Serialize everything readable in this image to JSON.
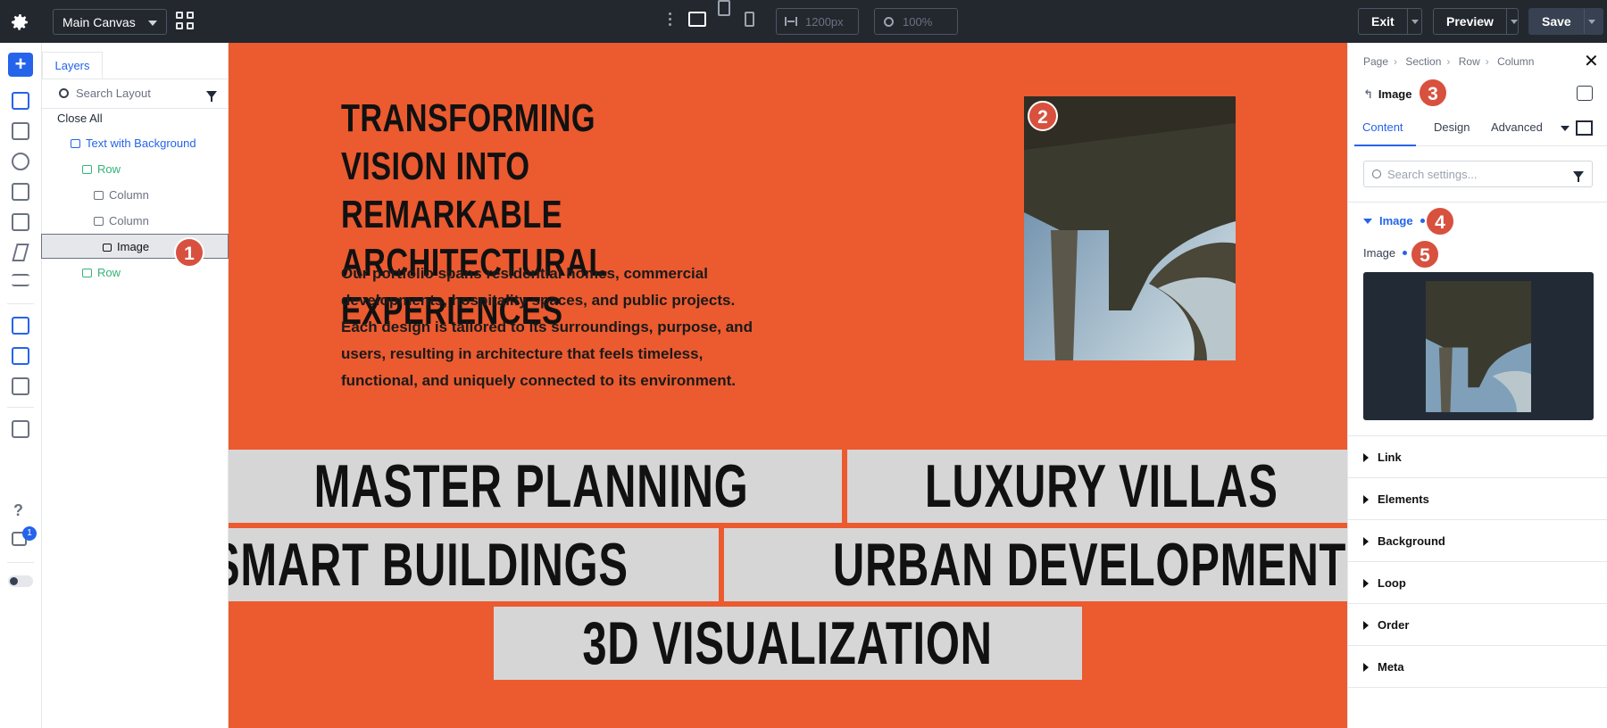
{
  "topbar": {
    "canvas_select": "Main Canvas",
    "width_value": "1200px",
    "zoom_value": "100%",
    "exit_label": "Exit",
    "preview_label": "Preview",
    "save_label": "Save"
  },
  "rail": {
    "add_label": "+",
    "help_label": "?",
    "notification_count": "1"
  },
  "layers": {
    "tab_label": "Layers",
    "search_placeholder": "Search Layout",
    "close_all": "Close All",
    "items": [
      {
        "label": "Text with Background"
      },
      {
        "label": "Row"
      },
      {
        "label": "Column"
      },
      {
        "label": "Column"
      },
      {
        "label": "Image"
      },
      {
        "label": "Row"
      }
    ]
  },
  "canvas": {
    "title_lines": [
      "TRANSFORMING VISION INTO",
      "REMARKABLE ARCHITECTURAL",
      "EXPERIENCES"
    ],
    "body_lines": [
      "Our portfolio spans residential homes, commercial",
      "developments, hospitality spaces, and public projects.",
      "Each design is tailored to its surroundings, purpose, and",
      "users, resulting in architecture that feels timeless,",
      "functional, and uniquely connected to its environment."
    ],
    "tags": [
      "MASTER PLANNING",
      "LUXURY VILLAS",
      "SMART BUILDINGS",
      "URBAN DEVELOPMENT",
      "3D VISUALIZATION"
    ]
  },
  "badges": [
    "1",
    "2",
    "3",
    "4",
    "5"
  ],
  "settings": {
    "breadcrumb": [
      "Page",
      "Section",
      "Row",
      "Column"
    ],
    "element_title": "Image",
    "tabs": [
      "Content",
      "Design",
      "Advanced"
    ],
    "search_placeholder": "Search settings...",
    "open_section": "Image",
    "field_label": "Image",
    "sections": [
      "Link",
      "Elements",
      "Background",
      "Loop",
      "Order",
      "Meta"
    ]
  },
  "colors": {
    "canvas_bg": "#ec5a2f",
    "accent": "#2563eb",
    "layer_green": "#34b37a",
    "badge": "#d8513e",
    "topbar": "#23282f"
  }
}
